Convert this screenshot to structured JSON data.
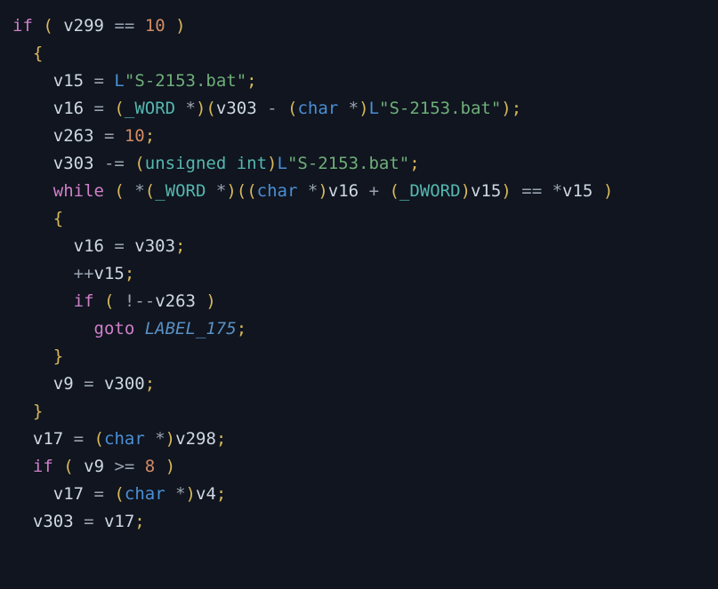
{
  "code": {
    "lines": [
      [
        {
          "cls": "tok-kw",
          "t": "if"
        },
        {
          "cls": "tok-ident",
          "t": " "
        },
        {
          "cls": "tok-punc",
          "t": "("
        },
        {
          "cls": "tok-ident",
          "t": " v299 "
        },
        {
          "cls": "tok-op",
          "t": "=="
        },
        {
          "cls": "tok-ident",
          "t": " "
        },
        {
          "cls": "tok-num",
          "t": "10"
        },
        {
          "cls": "tok-ident",
          "t": " "
        },
        {
          "cls": "tok-punc",
          "t": ")"
        }
      ],
      [
        {
          "cls": "tok-ident",
          "t": "  "
        },
        {
          "cls": "tok-punc",
          "t": "{"
        }
      ],
      [
        {
          "cls": "tok-ident",
          "t": "    v15 "
        },
        {
          "cls": "tok-op",
          "t": "="
        },
        {
          "cls": "tok-ident",
          "t": " "
        },
        {
          "cls": "tok-pfx",
          "t": "L"
        },
        {
          "cls": "tok-str",
          "t": "\"S-2153.bat\""
        },
        {
          "cls": "tok-punc",
          "t": ";"
        }
      ],
      [
        {
          "cls": "tok-ident",
          "t": "    v16 "
        },
        {
          "cls": "tok-op",
          "t": "="
        },
        {
          "cls": "tok-ident",
          "t": " "
        },
        {
          "cls": "tok-punc",
          "t": "("
        },
        {
          "cls": "tok-type",
          "t": "_WORD"
        },
        {
          "cls": "tok-ident",
          "t": " "
        },
        {
          "cls": "tok-deref",
          "t": "*"
        },
        {
          "cls": "tok-punc",
          "t": ")("
        },
        {
          "cls": "tok-ident",
          "t": "v303 "
        },
        {
          "cls": "tok-op",
          "t": "-"
        },
        {
          "cls": "tok-ident",
          "t": " "
        },
        {
          "cls": "tok-punc",
          "t": "("
        },
        {
          "cls": "tok-pfx",
          "t": "char"
        },
        {
          "cls": "tok-ident",
          "t": " "
        },
        {
          "cls": "tok-deref",
          "t": "*"
        },
        {
          "cls": "tok-punc",
          "t": ")"
        },
        {
          "cls": "tok-pfx",
          "t": "L"
        },
        {
          "cls": "tok-str",
          "t": "\"S-2153.bat\""
        },
        {
          "cls": "tok-punc",
          "t": ");"
        }
      ],
      [
        {
          "cls": "tok-ident",
          "t": "    v263 "
        },
        {
          "cls": "tok-op",
          "t": "="
        },
        {
          "cls": "tok-ident",
          "t": " "
        },
        {
          "cls": "tok-num",
          "t": "10"
        },
        {
          "cls": "tok-punc",
          "t": ";"
        }
      ],
      [
        {
          "cls": "tok-ident",
          "t": "    v303 "
        },
        {
          "cls": "tok-op",
          "t": "-="
        },
        {
          "cls": "tok-ident",
          "t": " "
        },
        {
          "cls": "tok-punc",
          "t": "("
        },
        {
          "cls": "tok-type",
          "t": "unsigned"
        },
        {
          "cls": "tok-ident",
          "t": " "
        },
        {
          "cls": "tok-type",
          "t": "int"
        },
        {
          "cls": "tok-punc",
          "t": ")"
        },
        {
          "cls": "tok-pfx",
          "t": "L"
        },
        {
          "cls": "tok-str",
          "t": "\"S-2153.bat\""
        },
        {
          "cls": "tok-punc",
          "t": ";"
        }
      ],
      [
        {
          "cls": "tok-ident",
          "t": "    "
        },
        {
          "cls": "tok-kw",
          "t": "while"
        },
        {
          "cls": "tok-ident",
          "t": " "
        },
        {
          "cls": "tok-punc",
          "t": "("
        },
        {
          "cls": "tok-ident",
          "t": " "
        },
        {
          "cls": "tok-deref",
          "t": "*"
        },
        {
          "cls": "tok-punc",
          "t": "("
        },
        {
          "cls": "tok-type",
          "t": "_WORD"
        },
        {
          "cls": "tok-ident",
          "t": " "
        },
        {
          "cls": "tok-deref",
          "t": "*"
        },
        {
          "cls": "tok-punc",
          "t": ")(("
        },
        {
          "cls": "tok-pfx",
          "t": "char"
        },
        {
          "cls": "tok-ident",
          "t": " "
        },
        {
          "cls": "tok-deref",
          "t": "*"
        },
        {
          "cls": "tok-punc",
          "t": ")"
        },
        {
          "cls": "tok-ident",
          "t": "v16 "
        },
        {
          "cls": "tok-op",
          "t": "+"
        },
        {
          "cls": "tok-ident",
          "t": " "
        },
        {
          "cls": "tok-punc",
          "t": "("
        },
        {
          "cls": "tok-type",
          "t": "_DWORD"
        },
        {
          "cls": "tok-punc",
          "t": ")"
        },
        {
          "cls": "tok-ident",
          "t": "v15"
        },
        {
          "cls": "tok-punc",
          "t": ")"
        },
        {
          "cls": "tok-ident",
          "t": " "
        },
        {
          "cls": "tok-op",
          "t": "=="
        },
        {
          "cls": "tok-ident",
          "t": " "
        },
        {
          "cls": "tok-deref",
          "t": "*"
        },
        {
          "cls": "tok-ident",
          "t": "v15 "
        },
        {
          "cls": "tok-punc",
          "t": ")"
        }
      ],
      [
        {
          "cls": "tok-ident",
          "t": "    "
        },
        {
          "cls": "tok-punc",
          "t": "{"
        }
      ],
      [
        {
          "cls": "tok-ident",
          "t": "      v16 "
        },
        {
          "cls": "tok-op",
          "t": "="
        },
        {
          "cls": "tok-ident",
          "t": " v303"
        },
        {
          "cls": "tok-punc",
          "t": ";"
        }
      ],
      [
        {
          "cls": "tok-ident",
          "t": "      "
        },
        {
          "cls": "tok-op",
          "t": "++"
        },
        {
          "cls": "tok-ident",
          "t": "v15"
        },
        {
          "cls": "tok-punc",
          "t": ";"
        }
      ],
      [
        {
          "cls": "tok-ident",
          "t": "      "
        },
        {
          "cls": "tok-kw",
          "t": "if"
        },
        {
          "cls": "tok-ident",
          "t": " "
        },
        {
          "cls": "tok-punc",
          "t": "("
        },
        {
          "cls": "tok-ident",
          "t": " "
        },
        {
          "cls": "tok-op",
          "t": "!--"
        },
        {
          "cls": "tok-ident",
          "t": "v263 "
        },
        {
          "cls": "tok-punc",
          "t": ")"
        }
      ],
      [
        {
          "cls": "tok-ident",
          "t": "        "
        },
        {
          "cls": "tok-kw",
          "t": "goto"
        },
        {
          "cls": "tok-ident",
          "t": " "
        },
        {
          "cls": "tok-label",
          "t": "LABEL_175"
        },
        {
          "cls": "tok-punc",
          "t": ";"
        }
      ],
      [
        {
          "cls": "tok-ident",
          "t": "    "
        },
        {
          "cls": "tok-punc",
          "t": "}"
        }
      ],
      [
        {
          "cls": "tok-ident",
          "t": "    v9 "
        },
        {
          "cls": "tok-op",
          "t": "="
        },
        {
          "cls": "tok-ident",
          "t": " v300"
        },
        {
          "cls": "tok-punc",
          "t": ";"
        }
      ],
      [
        {
          "cls": "tok-ident",
          "t": "  "
        },
        {
          "cls": "tok-punc",
          "t": "}"
        }
      ],
      [
        {
          "cls": "tok-ident",
          "t": "  v17 "
        },
        {
          "cls": "tok-op",
          "t": "="
        },
        {
          "cls": "tok-ident",
          "t": " "
        },
        {
          "cls": "tok-punc",
          "t": "("
        },
        {
          "cls": "tok-pfx",
          "t": "char"
        },
        {
          "cls": "tok-ident",
          "t": " "
        },
        {
          "cls": "tok-deref",
          "t": "*"
        },
        {
          "cls": "tok-punc",
          "t": ")"
        },
        {
          "cls": "tok-ident",
          "t": "v298"
        },
        {
          "cls": "tok-punc",
          "t": ";"
        }
      ],
      [
        {
          "cls": "tok-ident",
          "t": "  "
        },
        {
          "cls": "tok-kw",
          "t": "if"
        },
        {
          "cls": "tok-ident",
          "t": " "
        },
        {
          "cls": "tok-punc",
          "t": "("
        },
        {
          "cls": "tok-ident",
          "t": " v9 "
        },
        {
          "cls": "tok-op",
          "t": ">="
        },
        {
          "cls": "tok-ident",
          "t": " "
        },
        {
          "cls": "tok-num",
          "t": "8"
        },
        {
          "cls": "tok-ident",
          "t": " "
        },
        {
          "cls": "tok-punc",
          "t": ")"
        }
      ],
      [
        {
          "cls": "tok-ident",
          "t": "    v17 "
        },
        {
          "cls": "tok-op",
          "t": "="
        },
        {
          "cls": "tok-ident",
          "t": " "
        },
        {
          "cls": "tok-punc",
          "t": "("
        },
        {
          "cls": "tok-pfx",
          "t": "char"
        },
        {
          "cls": "tok-ident",
          "t": " "
        },
        {
          "cls": "tok-deref",
          "t": "*"
        },
        {
          "cls": "tok-punc",
          "t": ")"
        },
        {
          "cls": "tok-ident",
          "t": "v4"
        },
        {
          "cls": "tok-punc",
          "t": ";"
        }
      ],
      [
        {
          "cls": "tok-ident",
          "t": "  v303 "
        },
        {
          "cls": "tok-op",
          "t": "="
        },
        {
          "cls": "tok-ident",
          "t": " v17"
        },
        {
          "cls": "tok-punc",
          "t": ";"
        }
      ]
    ]
  }
}
